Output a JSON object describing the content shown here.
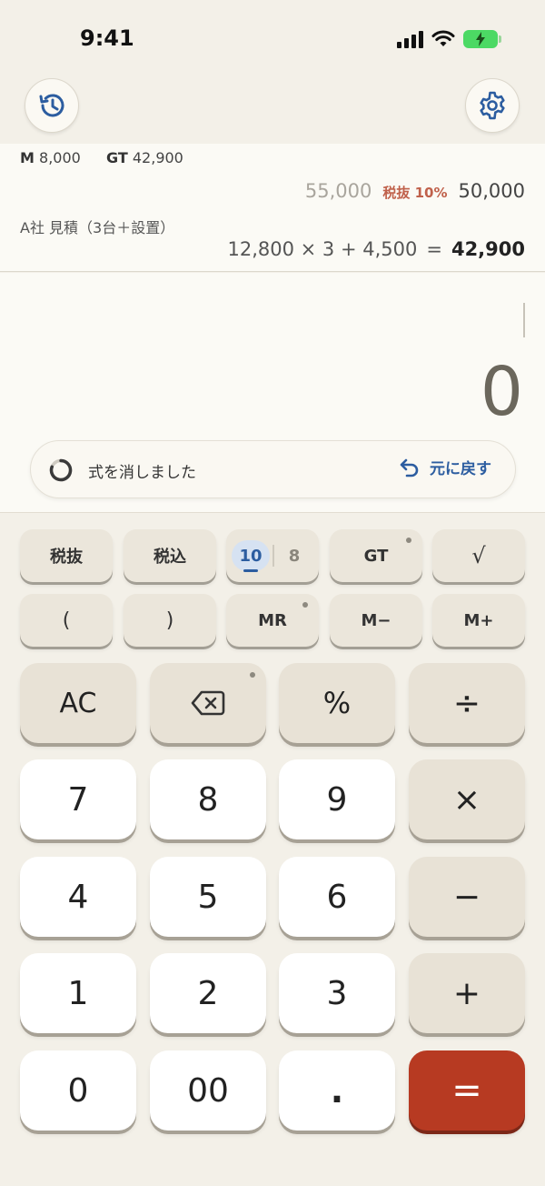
{
  "status": {
    "time": "9:41"
  },
  "header": {
    "history_icon": "history-clock-icon",
    "settings_icon": "gear-icon"
  },
  "tape": {
    "memory_label": "M",
    "memory_value": "8,000",
    "gt_label": "GT",
    "gt_value": "42,900",
    "prev_gross": "55,000",
    "prev_tax_label": "税抜 10%",
    "prev_net": "50,000",
    "memo": "A社 見積（3台＋設置）",
    "expression": "12,800 × 3 + 4,500",
    "equals": "=",
    "result": "42,900"
  },
  "display": {
    "value": "0"
  },
  "toast": {
    "message": "式を消しました",
    "undo_label": "元に戻す"
  },
  "keys": {
    "tax_excl": "税抜",
    "tax_incl": "税込",
    "round_active": "10",
    "round_alt": "8",
    "gt": "GT",
    "sqrt": "√",
    "paren_open": "(",
    "paren_close": ")",
    "mr": "MR",
    "m_minus": "M−",
    "m_plus": "M+",
    "ac": "AC",
    "percent": "%",
    "divide": "÷",
    "multiply": "×",
    "minus": "−",
    "plus": "+",
    "equals": "=",
    "seven": "7",
    "eight": "8",
    "nine": "9",
    "four": "4",
    "five": "5",
    "six": "6",
    "one": "1",
    "two": "2",
    "three": "3",
    "zero": "0",
    "double_zero": "00",
    "decimal": "."
  },
  "colors": {
    "accent_blue": "#2c5da0",
    "equals_red": "#b73a22",
    "tax_red": "#c0614b"
  }
}
